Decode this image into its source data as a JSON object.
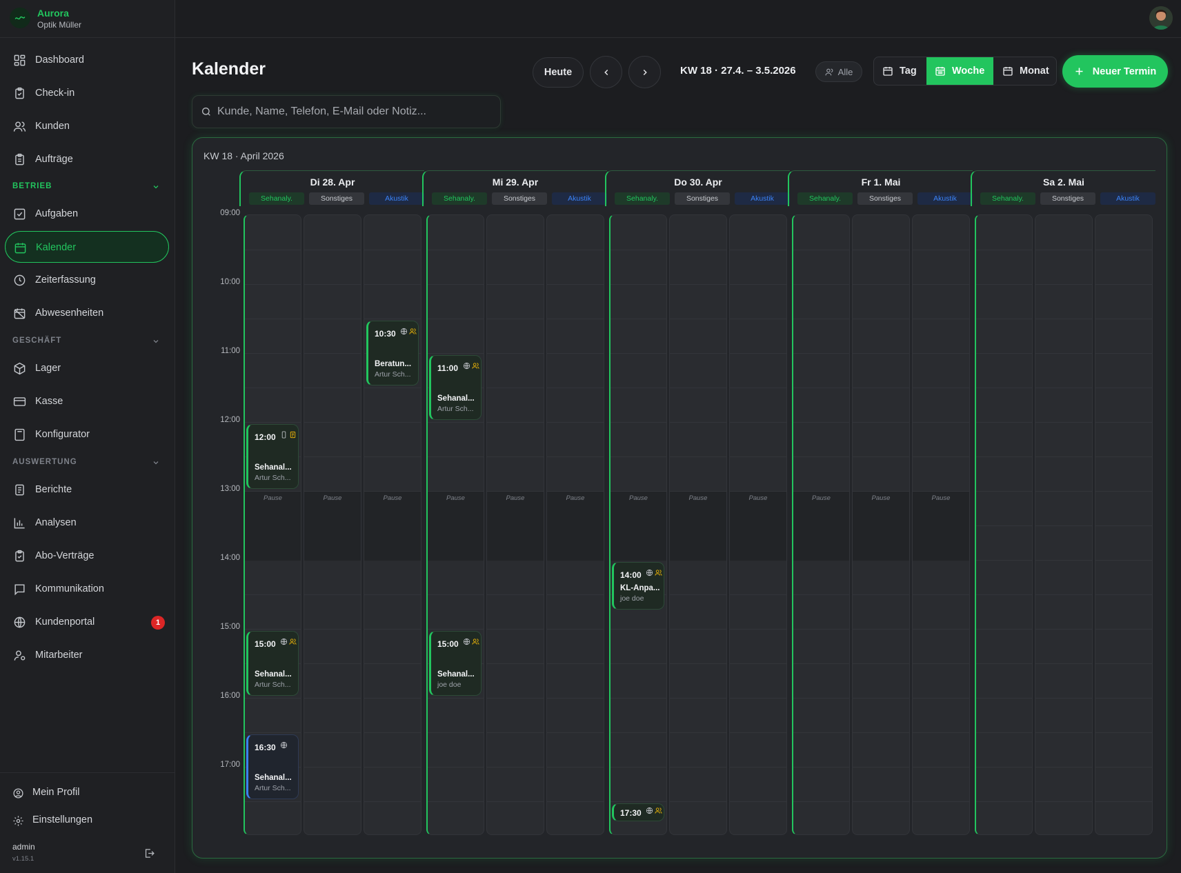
{
  "brand": {
    "name": "Aurora",
    "sub": "Optik Müller"
  },
  "nav": {
    "dashboard": "Dashboard",
    "checkin": "Check-in",
    "kunden": "Kunden",
    "auftraege": "Aufträge",
    "betrieb": "BETRIEB",
    "aufgaben": "Aufgaben",
    "kalender": "Kalender",
    "zeiterfassung": "Zeiterfassung",
    "abwesenheiten": "Abwesenheiten",
    "geschaeft": "GESCHÄFT",
    "lager": "Lager",
    "kasse": "Kasse",
    "konfigurator": "Konfigurator",
    "auswertung": "AUSWERTUNG",
    "berichte": "Berichte",
    "analysen": "Analysen",
    "abo": "Abo-Verträge",
    "kommunikation": "Kommunikation",
    "kundenportal": "Kundenportal",
    "kundenportal_badge": "1",
    "mitarbeiter": "Mitarbeiter"
  },
  "footer": {
    "profil": "Mein Profil",
    "einstellungen": "Einstellungen",
    "user": "admin",
    "version": "v1.15.1"
  },
  "header": {
    "title": "Kalender",
    "today": "Heute",
    "week": "KW 18 · 27.4. – 3.5.2026",
    "filter": "Alle",
    "view_day": "Tag",
    "view_week": "Woche",
    "view_month": "Monat",
    "new": "Neuer Termin"
  },
  "search": {
    "placeholder": "Kunde, Name, Telefon, E-Mail oder Notiz..."
  },
  "calendar": {
    "title": "KW 18 · April 2026",
    "times": [
      "09:00",
      "10:00",
      "11:00",
      "12:00",
      "13:00",
      "14:00",
      "15:00",
      "16:00",
      "17:00"
    ],
    "pause_label": "Pause",
    "tags": [
      "Sehanaly.",
      "Sonstiges",
      "Akustik"
    ],
    "days": [
      {
        "name": "Di 28. Apr",
        "pause": true
      },
      {
        "name": "Mi 29. Apr",
        "pause": true
      },
      {
        "name": "Do 30. Apr",
        "pause": true
      },
      {
        "name": "Fr 1. Mai",
        "pause": true
      },
      {
        "name": "Sa 2. Mai",
        "pause": false
      }
    ],
    "events": [
      {
        "day": 0,
        "col": 0,
        "start": "12:00",
        "end": "13:00",
        "time": "12:00",
        "title": "Sehanal...",
        "sub": "Artur Sch...",
        "icons": [
          "phone-icon",
          "note-icon",
          "people-icon"
        ],
        "color": "#22c55e"
      },
      {
        "day": 0,
        "col": 0,
        "start": "15:00",
        "end": "16:00",
        "time": "15:00",
        "title": "Sehanal...",
        "sub": "Artur Sch...",
        "icons": [
          "globe-icon",
          "people-icon"
        ],
        "color": "#22c55e"
      },
      {
        "day": 0,
        "col": 0,
        "start": "16:30",
        "end": "17:30",
        "time": "16:30",
        "title": "Sehanal...",
        "sub": "Artur Sch...",
        "icons": [
          "globe-icon"
        ],
        "color": "#3b82f6"
      },
      {
        "day": 0,
        "col": 2,
        "start": "10:30",
        "end": "11:30",
        "time": "10:30",
        "title": "Beratun...",
        "sub": "Artur Sch...",
        "icons": [
          "globe-icon",
          "people-icon"
        ],
        "color": "#22c55e"
      },
      {
        "day": 1,
        "col": 0,
        "start": "11:00",
        "end": "12:00",
        "time": "11:00",
        "title": "Sehanal...",
        "sub": "Artur Sch...",
        "icons": [
          "globe-icon",
          "people-icon"
        ],
        "color": "#22c55e"
      },
      {
        "day": 1,
        "col": 0,
        "start": "15:00",
        "end": "16:00",
        "time": "15:00",
        "title": "Sehanal...",
        "sub": "joe doe",
        "icons": [
          "globe-icon",
          "people-icon"
        ],
        "color": "#22c55e"
      },
      {
        "day": 2,
        "col": 0,
        "start": "14:00",
        "end": "14:45",
        "time": "14:00",
        "title": "KL-Anpa...",
        "sub": "joe doe",
        "icons": [
          "globe-icon",
          "people-icon"
        ],
        "color": "#22c55e"
      },
      {
        "day": 2,
        "col": 0,
        "start": "17:30",
        "end": "17:45",
        "time": "17:30",
        "title": "",
        "sub": "",
        "icons": [
          "globe-icon",
          "people-icon"
        ],
        "color": "#22c55e"
      }
    ]
  }
}
